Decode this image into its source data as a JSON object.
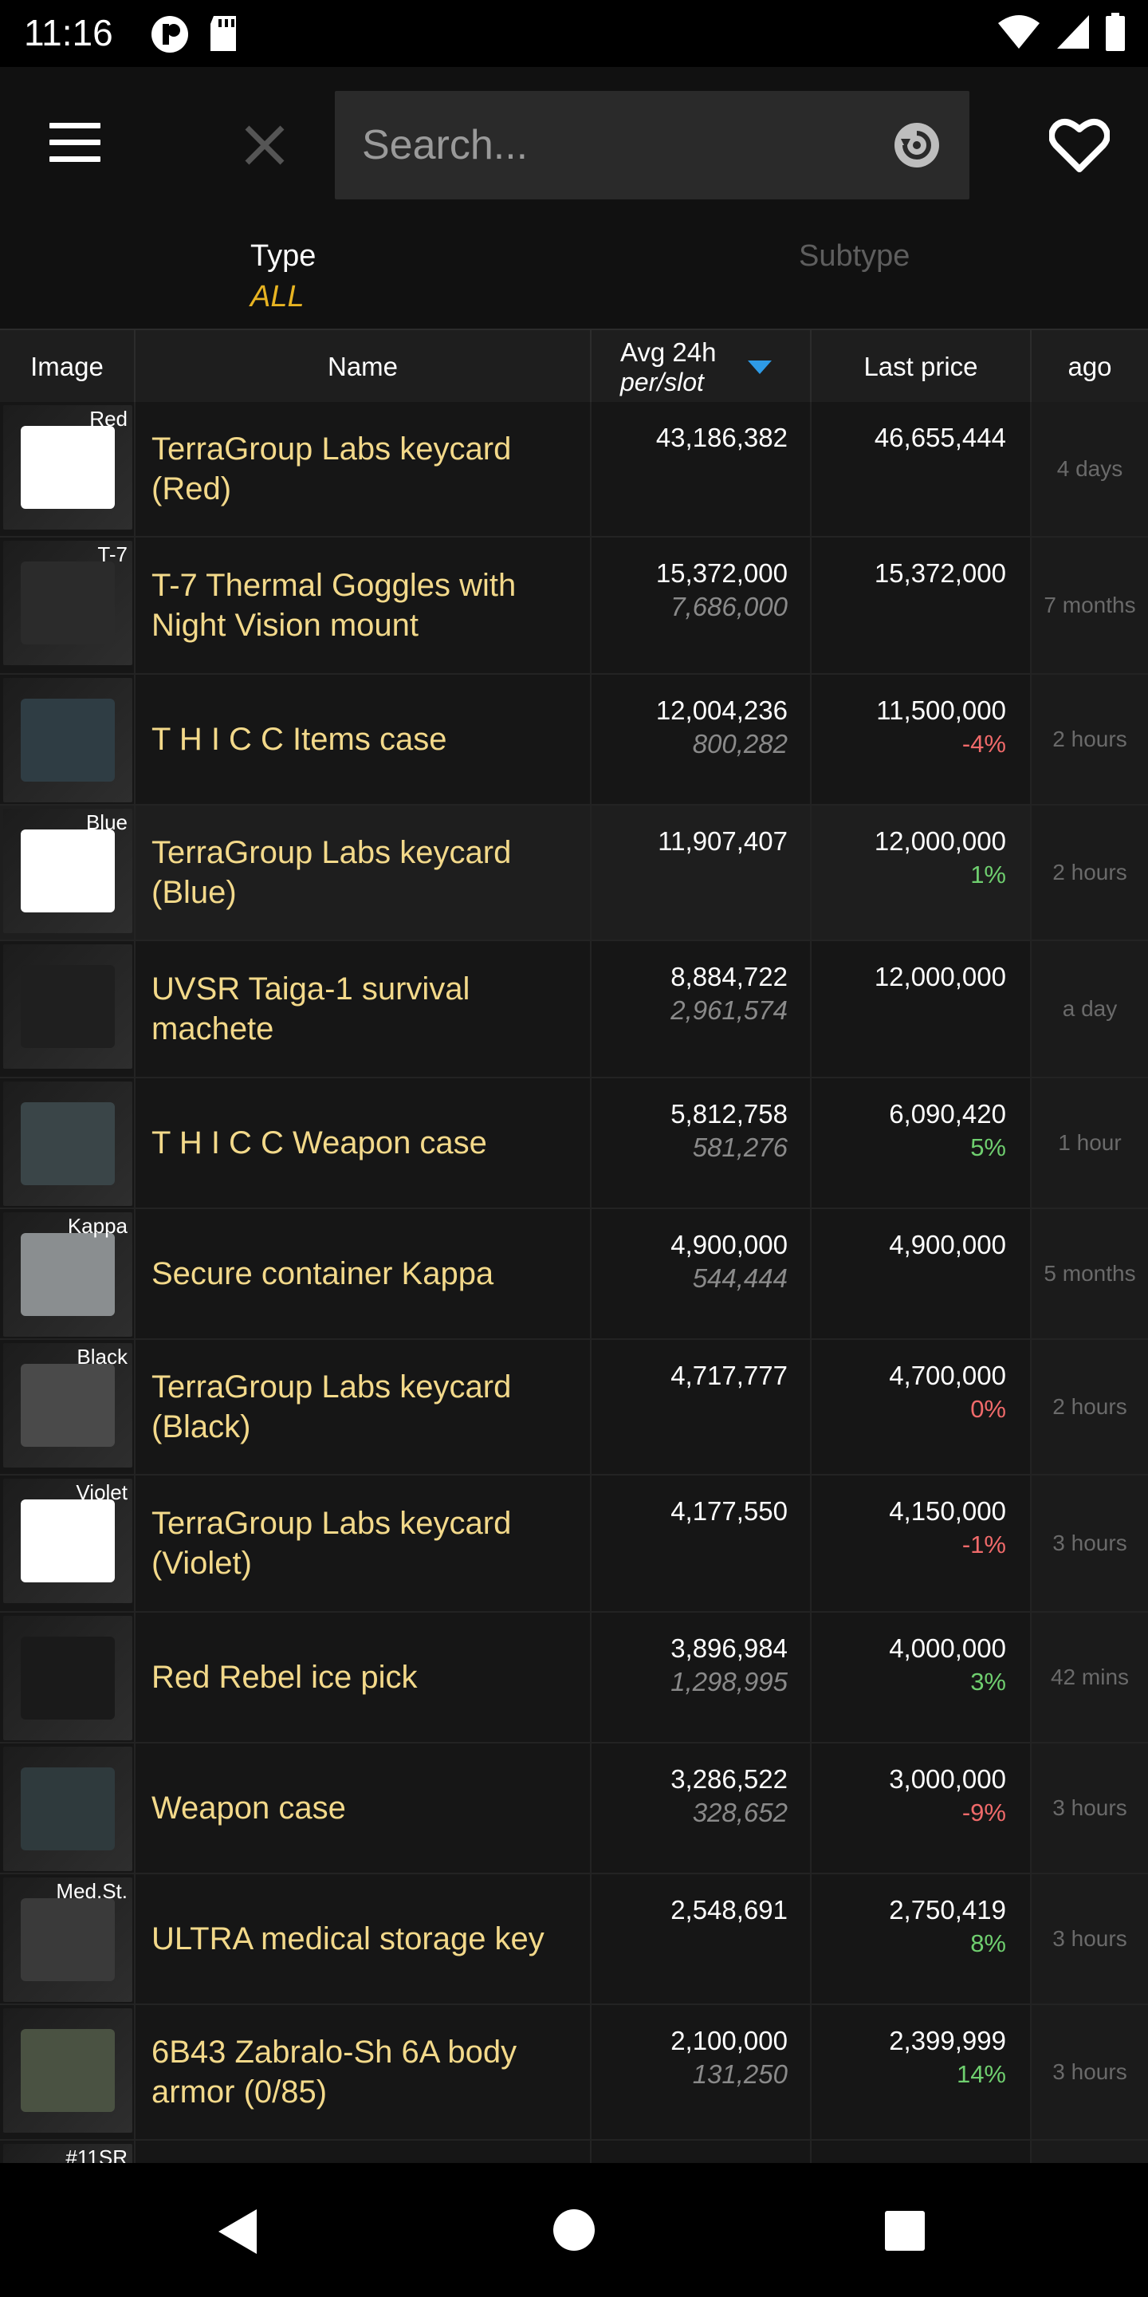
{
  "status_bar": {
    "time": "11:16"
  },
  "search": {
    "placeholder": "Search..."
  },
  "filters": {
    "type_label": "Type",
    "type_value": "ALL",
    "subtype_label": "Subtype"
  },
  "table": {
    "columns": {
      "image": "Image",
      "name": "Name",
      "avg": "Avg 24h",
      "avg_sub": "per/slot",
      "last": "Last price",
      "ago": "ago"
    },
    "rows": [
      {
        "thumb_label": "Red",
        "thumb_color": "#ffffff",
        "name": "TerraGroup Labs keycard (Red)",
        "avg": "43,186,382",
        "per_slot": "",
        "last": "46,655,444",
        "change": "",
        "ago": "4 days"
      },
      {
        "thumb_label": "T-7",
        "thumb_color": "#2b2b2b",
        "name": "T-7 Thermal Goggles with Night Vision mount",
        "avg": "15,372,000",
        "per_slot": "7,686,000",
        "last": "15,372,000",
        "change": "",
        "ago": "7 months"
      },
      {
        "thumb_label": "",
        "thumb_color": "#2f3d44",
        "name": "T H I C C Items case",
        "avg": "12,004,236",
        "per_slot": "800,282",
        "last": "11,500,000",
        "change": "-4%",
        "ago": "2 hours"
      },
      {
        "thumb_label": "Blue",
        "thumb_color": "#ffffff",
        "name": "TerraGroup Labs keycard (Blue)",
        "avg": "11,907,407",
        "per_slot": "",
        "last": "12,000,000",
        "change": "1%",
        "ago": "2 hours"
      },
      {
        "thumb_label": "",
        "thumb_color": "#1f1f1f",
        "name": "UVSR Taiga-1 survival machete",
        "avg": "8,884,722",
        "per_slot": "2,961,574",
        "last": "12,000,000",
        "change": "",
        "ago": "a day"
      },
      {
        "thumb_label": "",
        "thumb_color": "#3a4548",
        "name": "T H I C C Weapon case",
        "avg": "5,812,758",
        "per_slot": "581,276",
        "last": "6,090,420",
        "change": "5%",
        "ago": "1 hour"
      },
      {
        "thumb_label": "Kappa",
        "thumb_color": "#8a8e90",
        "name": "Secure container Kappa",
        "avg": "4,900,000",
        "per_slot": "544,444",
        "last": "4,900,000",
        "change": "",
        "ago": "5 months"
      },
      {
        "thumb_label": "Black",
        "thumb_color": "#4a4a4a",
        "name": "TerraGroup Labs keycard (Black)",
        "avg": "4,717,777",
        "per_slot": "",
        "last": "4,700,000",
        "change": "0%",
        "ago": "2 hours"
      },
      {
        "thumb_label": "Violet",
        "thumb_color": "#ffffff",
        "name": "TerraGroup Labs keycard (Violet)",
        "avg": "4,177,550",
        "per_slot": "",
        "last": "4,150,000",
        "change": "-1%",
        "ago": "3 hours"
      },
      {
        "thumb_label": "",
        "thumb_color": "#1a1a1a",
        "name": "Red Rebel ice pick",
        "avg": "3,896,984",
        "per_slot": "1,298,995",
        "last": "4,000,000",
        "change": "3%",
        "ago": "42 mins"
      },
      {
        "thumb_label": "",
        "thumb_color": "#2f3a3d",
        "name": "Weapon case",
        "avg": "3,286,522",
        "per_slot": "328,652",
        "last": "3,000,000",
        "change": "-9%",
        "ago": "3 hours"
      },
      {
        "thumb_label": "Med.St.",
        "thumb_color": "#3a3a3a",
        "name": "ULTRA medical storage key",
        "avg": "2,548,691",
        "per_slot": "",
        "last": "2,750,419",
        "change": "8%",
        "ago": "3 hours"
      },
      {
        "thumb_label": "",
        "thumb_color": "#4a5242",
        "name": "6B43 Zabralo-Sh 6A body armor (0/85)",
        "avg": "2,100,000",
        "per_slot": "131,250",
        "last": "2,399,999",
        "change": "14%",
        "ago": "3 hours"
      },
      {
        "thumb_label": "#11SR",
        "thumb_color": "#3a3a3a",
        "name": "",
        "avg": "",
        "per_slot": "",
        "last": "",
        "change": "",
        "ago": ""
      }
    ]
  },
  "colors": {
    "accent": "#e8b422",
    "name_text": "#f3d98a",
    "sort_arrow": "#2e9be6",
    "positive": "#6fcf6f",
    "negative": "#f06a6a"
  },
  "icons": [
    "menu-icon",
    "close-icon",
    "reset-icon",
    "heart-icon",
    "sort-desc-icon",
    "back-icon",
    "home-icon",
    "recents-icon"
  ]
}
